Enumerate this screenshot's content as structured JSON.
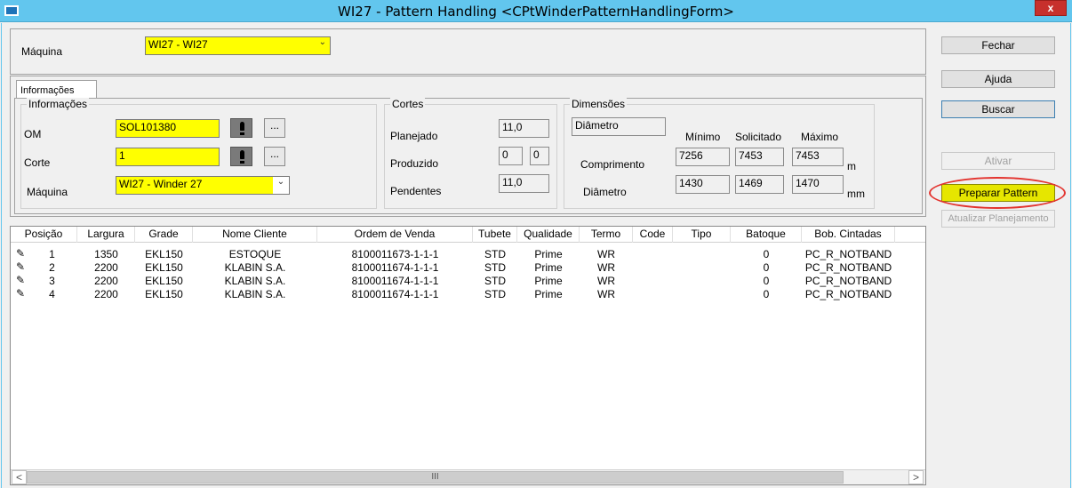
{
  "window": {
    "title": "WI27 - Pattern Handling <CPtWinderPatternHandlingForm>",
    "close_label": "x"
  },
  "machine": {
    "label": "Máquina",
    "value": "WI27 - WI27"
  },
  "tab": {
    "label": "Informações"
  },
  "info_group": {
    "title": "Informações",
    "om_label": "OM",
    "om_value": "SOL101380",
    "corte_label": "Corte",
    "corte_value": "1",
    "maquina_label": "Máquina",
    "maquina_value": "WI27 - Winder 27",
    "dots": "..."
  },
  "cortes_group": {
    "title": "Cortes",
    "planejado_label": "Planejado",
    "planejado_value": "11,0",
    "produzido_label": "Produzido",
    "produzido_value1": "0",
    "produzido_value2": "0",
    "pendentes_label": "Pendentes",
    "pendentes_value": "11,0"
  },
  "dimensoes_group": {
    "title": "Dimensões",
    "select_value": "Diâmetro",
    "minimo_label": "Mínimo",
    "solicitado_label": "Solicitado",
    "maximo_label": "Máximo",
    "comprimento_label": "Comprimento",
    "comprimento_min": "7256",
    "comprimento_sol": "7453",
    "comprimento_max": "7453",
    "comprimento_unit": "m",
    "diametro_label": "Diâmetro",
    "diametro_min": "1430",
    "diametro_sol": "1469",
    "diametro_max": "1470",
    "diametro_unit": "mm"
  },
  "grid": {
    "columns": [
      "Posição",
      "Largura",
      "Grade",
      "Nome Cliente",
      "Ordem de Venda",
      "Tubete",
      "Qualidade",
      "Termo",
      "Code",
      "Tipo",
      "Batoque",
      "Bob. Cintadas"
    ],
    "rows": [
      [
        "1",
        "1350",
        "EKL150",
        "ESTOQUE",
        "8100011673-1-1-1",
        "STD",
        "Prime",
        "WR",
        "",
        "",
        "0",
        "PC_R_NOTBAND"
      ],
      [
        "2",
        "2200",
        "EKL150",
        "KLABIN S.A.",
        "8100011674-1-1-1",
        "STD",
        "Prime",
        "WR",
        "",
        "",
        "0",
        "PC_R_NOTBAND"
      ],
      [
        "3",
        "2200",
        "EKL150",
        "KLABIN S.A.",
        "8100011674-1-1-1",
        "STD",
        "Prime",
        "WR",
        "",
        "",
        "0",
        "PC_R_NOTBAND"
      ],
      [
        "4",
        "2200",
        "EKL150",
        "KLABIN S.A.",
        "8100011674-1-1-1",
        "STD",
        "Prime",
        "WR",
        "",
        "",
        "0",
        "PC_R_NOTBAND"
      ]
    ],
    "scroll_left": "<",
    "scroll_right": ">",
    "scroll_grip": "III"
  },
  "buttons": {
    "fechar": "Fechar",
    "ajuda": "Ajuda",
    "buscar": "Buscar",
    "ativar": "Ativar",
    "preparar": "Preparar Pattern",
    "atualizar": "Atualizar Planejamento"
  },
  "colors": {
    "highlight": "#ffff00",
    "titlebar": "#62c6ee",
    "annotation": "#e3342f"
  }
}
